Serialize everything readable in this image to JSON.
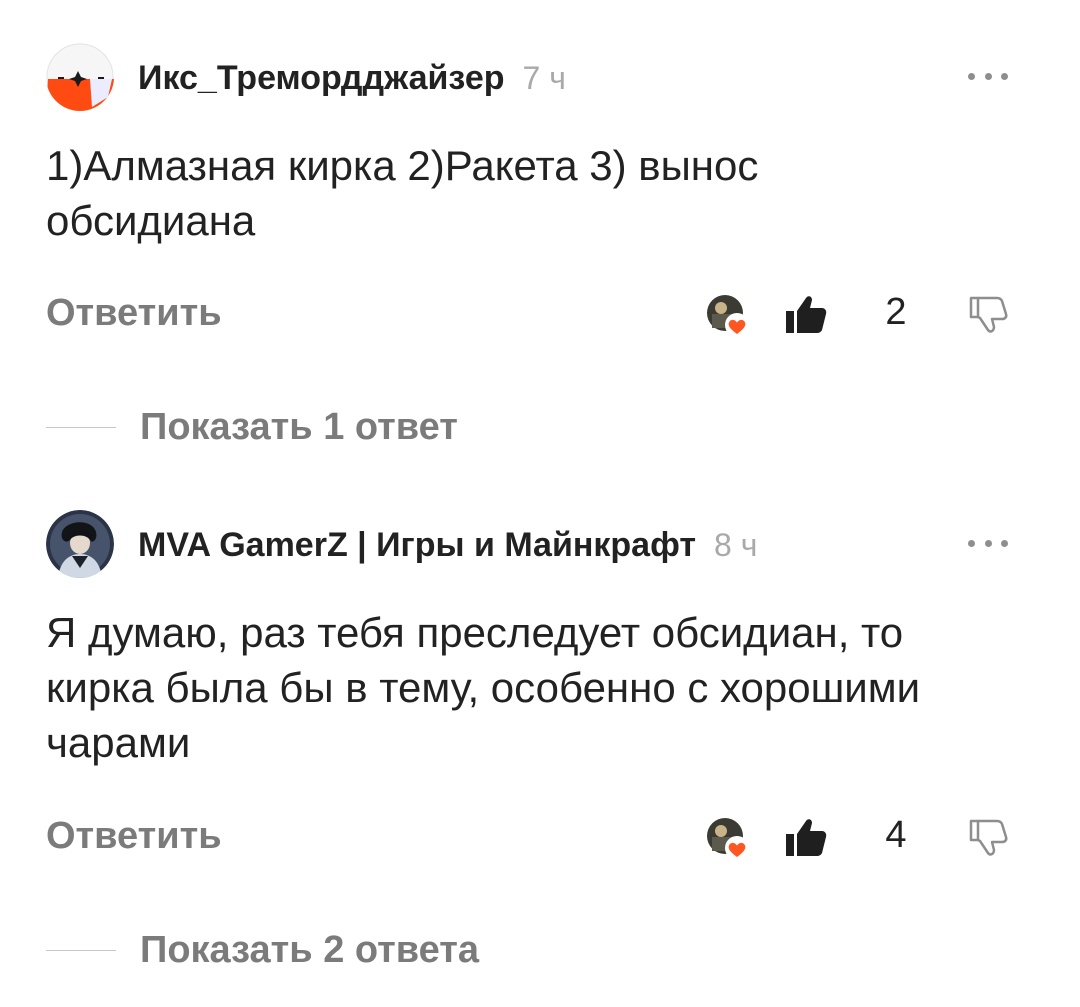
{
  "comments": [
    {
      "author": "Икс_Тремордджайзер",
      "time": "7 ч",
      "text_lines": [
        "1)Алмазная кирка 2)Ракета 3) вынос",
        "обсидиана"
      ],
      "reply_label": "Ответить",
      "likes": "2",
      "show_replies": "Показать 1 ответ"
    },
    {
      "author": "MVA GamerZ | Игры и Майнкрафт",
      "time": "8 ч",
      "text_lines": [
        "Я думаю, раз тебя преследует обсидиан, то",
        "кирка была бы в тему, особенно с хорошими",
        "чарами"
      ],
      "reply_label": "Ответить",
      "likes": "4",
      "show_replies": "Показать 2 ответа"
    }
  ],
  "colors": {
    "accent": "#ff5722",
    "text": "#222222",
    "muted": "#7b7b7b",
    "time": "#a9a9a9"
  },
  "icons": {
    "more": "more-dots-icon",
    "like": "thumb-up-icon",
    "dislike": "thumb-down-icon",
    "reaction": "heart-reaction-icon"
  }
}
